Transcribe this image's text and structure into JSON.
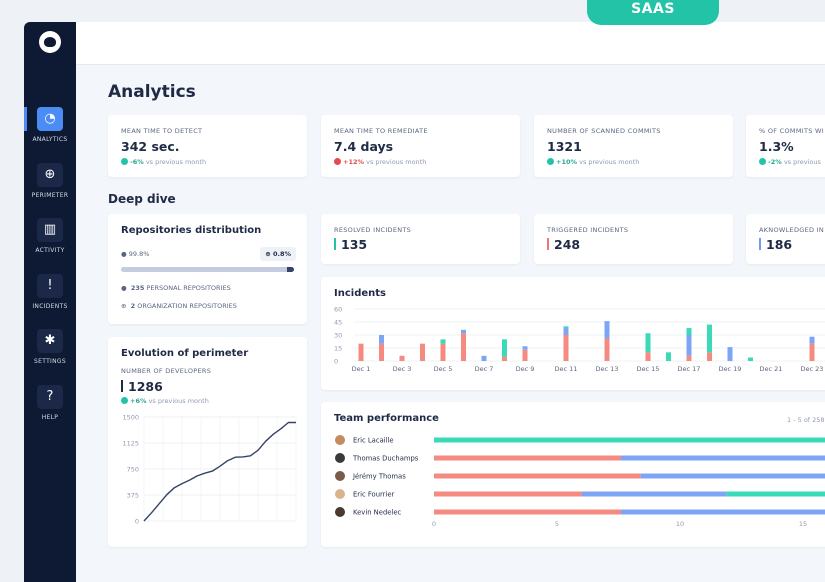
{
  "badge": "SAAS",
  "sidebar": {
    "items": [
      {
        "label": "ANALYTICS",
        "icon": "pie-chart-icon",
        "glyph": "◔"
      },
      {
        "label": "PERIMETER",
        "icon": "globe-icon",
        "glyph": "⊕"
      },
      {
        "label": "ACTIVITY",
        "icon": "bar-chart-icon",
        "glyph": "▥"
      },
      {
        "label": "INCIDENTS",
        "icon": "alert-icon",
        "glyph": "!"
      },
      {
        "label": "SETTINGS",
        "icon": "gear-icon",
        "glyph": "✱"
      },
      {
        "label": "HELP",
        "icon": "help-icon",
        "glyph": "?"
      }
    ]
  },
  "page": {
    "title": "Analytics",
    "section_title": "Deep dive"
  },
  "kpis": [
    {
      "label": "MEAN TIME TO DETECT",
      "value": "342 sec.",
      "delta": "-6%",
      "direction": "up",
      "note": "vs previous month"
    },
    {
      "label": "MEAN TIME TO REMEDIATE",
      "value": "7.4 days",
      "delta": "+12%",
      "direction": "down",
      "note": "vs previous month"
    },
    {
      "label": "NUMBER OF SCANNED COMMITS",
      "value": "1321",
      "delta": "+10%",
      "direction": "up",
      "note": "vs previous month"
    },
    {
      "label": "% OF COMMITS WI",
      "value": "1.3%",
      "delta": "-2%",
      "direction": "up",
      "note": "vs previous"
    }
  ],
  "repos": {
    "title": "Repositories distribution",
    "personal_pct": "99.8%",
    "org_pct": "0.8%",
    "personal_count": "235",
    "personal_label": "PERSONAL REPOSITORIES",
    "org_count": "2",
    "org_label": "ORGANIZATION REPOSITORIES",
    "personal_fraction": 0.96
  },
  "incident_counts": [
    {
      "label": "RESOLVED INCIDENTS",
      "value": "135",
      "color": "#23c3a8"
    },
    {
      "label": "TRIGGERED INCIDENTS",
      "value": "248",
      "color": "#f0776c"
    },
    {
      "label": "AKNOWLEDGED IN",
      "value": "186",
      "color": "#6f9bf0"
    }
  ],
  "perimeter": {
    "title": "Evolution of perimeter",
    "label": "NUMBER OF DEVELOPERS",
    "value": "1286",
    "delta": "+6%",
    "note": "vs previous month"
  },
  "team": {
    "title": "Team performance",
    "pagination": "1 - 5 of 258"
  },
  "colors": {
    "resolved": "#3ad9b8",
    "triggered": "#f58a80",
    "acknowledged": "#7ea5f5",
    "line": "#33436a"
  },
  "chart_data": [
    {
      "type": "bar",
      "title": "Incidents",
      "stacked": true,
      "ylim": [
        0,
        60
      ],
      "yticks": [
        0,
        15,
        30,
        45,
        60
      ],
      "xticks": [
        "Dec 1",
        "Dec 3",
        "Dec 5",
        "Dec 7",
        "Dec 9",
        "Dec 11",
        "Dec 13",
        "Dec 15",
        "Dec 17",
        "Dec 19",
        "Dec 21",
        "Dec 23"
      ],
      "categories": [
        "Dec 1",
        "Dec 2",
        "Dec 3",
        "Dec 4",
        "Dec 5",
        "Dec 6",
        "Dec 7",
        "Dec 8",
        "Dec 9",
        "Dec 10",
        "Dec 11",
        "Dec 12",
        "Dec 13",
        "Dec 14",
        "Dec 15",
        "Dec 16",
        "Dec 17",
        "Dec 18",
        "Dec 19",
        "Dec 20",
        "Dec 21",
        "Dec 22",
        "Dec 23",
        "Dec 24"
      ],
      "series": [
        {
          "key": "triggered",
          "values": [
            20,
            20,
            6,
            20,
            20,
            32,
            0,
            5,
            13,
            0,
            30,
            0,
            26,
            0,
            10,
            0,
            6,
            10,
            0,
            0,
            0,
            0,
            20,
            28
          ]
        },
        {
          "key": "acknowledged",
          "values": [
            0,
            10,
            0,
            0,
            0,
            4,
            6,
            0,
            4,
            0,
            8,
            0,
            20,
            0,
            0,
            0,
            24,
            0,
            16,
            0,
            0,
            0,
            8,
            0
          ]
        },
        {
          "key": "resolved",
          "values": [
            0,
            0,
            0,
            0,
            5,
            0,
            0,
            20,
            0,
            0,
            2,
            0,
            0,
            0,
            22,
            10,
            8,
            32,
            0,
            4,
            0,
            0,
            0,
            0
          ]
        }
      ]
    },
    {
      "type": "line",
      "title": "Evolution of perimeter",
      "ylim": [
        0,
        1500
      ],
      "yticks": [
        0,
        375,
        750,
        1125,
        1500
      ],
      "x": [
        0,
        1,
        2,
        3,
        4,
        5,
        6,
        7,
        8,
        9,
        10,
        11,
        12,
        13,
        14,
        15,
        16,
        17,
        18,
        19,
        20
      ],
      "values": [
        0,
        120,
        250,
        380,
        480,
        540,
        590,
        650,
        690,
        720,
        790,
        870,
        920,
        925,
        940,
        1020,
        1150,
        1250,
        1330,
        1420,
        1420
      ]
    },
    {
      "type": "bar",
      "orientation": "horizontal",
      "title": "Team performance",
      "stacked": true,
      "xlim": [
        0,
        20
      ],
      "xticks": [
        0,
        5,
        10,
        15
      ],
      "categories": [
        "Eric Lacaille",
        "Thomas Duchamps",
        "Jérémy Thomas",
        "Eric Fourrier",
        "Kevin Nedelec"
      ],
      "series": [
        {
          "key": "triggered",
          "values": [
            0,
            7.6,
            8.4,
            6.0,
            7.6
          ]
        },
        {
          "key": "acknowledged",
          "values": [
            0,
            12.4,
            8.6,
            5.9,
            12.4
          ]
        },
        {
          "key": "resolved",
          "values": [
            20,
            0,
            3.0,
            6.0,
            0
          ]
        }
      ]
    }
  ]
}
